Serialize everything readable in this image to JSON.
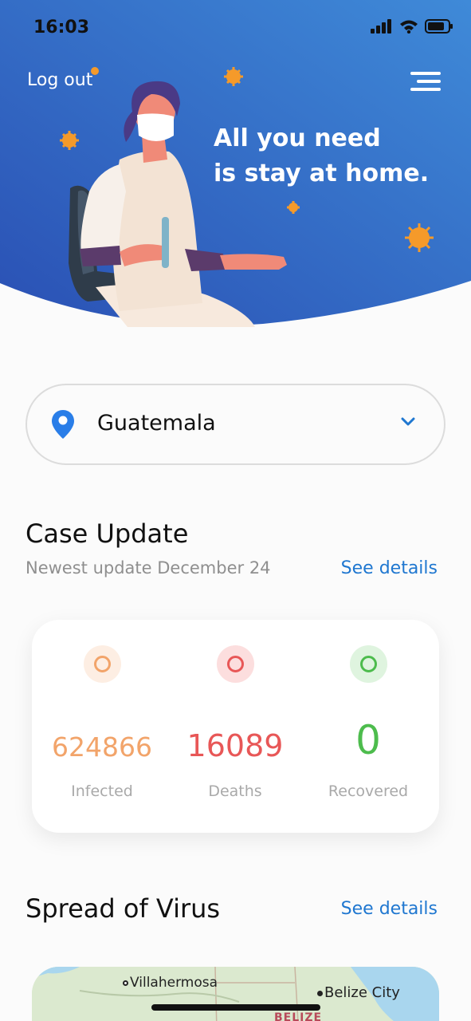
{
  "status": {
    "time": "16:03"
  },
  "header": {
    "logout_label": "Log out",
    "title_line1": "All you need",
    "title_line2": "is stay at home."
  },
  "location": {
    "country": "Guatemala"
  },
  "case_update": {
    "title": "Case Update",
    "subtitle": "Newest update December 24",
    "link": "See details",
    "stats": [
      {
        "label": "Infected",
        "value": "624866",
        "color": "#f2a46a"
      },
      {
        "label": "Deaths",
        "value": "16089",
        "color": "#e85757"
      },
      {
        "label": "Recovered",
        "value": "0",
        "color": "#4dbc4d"
      }
    ]
  },
  "spread": {
    "title": "Spread of Virus",
    "link": "See details",
    "map_places": [
      "Villahermosa",
      "Belize City",
      "BELIZE"
    ]
  },
  "colors": {
    "accent": "#1f77d0",
    "hero_gradient_start": "#2a56b8",
    "hero_gradient_end": "#3f8ad8"
  }
}
